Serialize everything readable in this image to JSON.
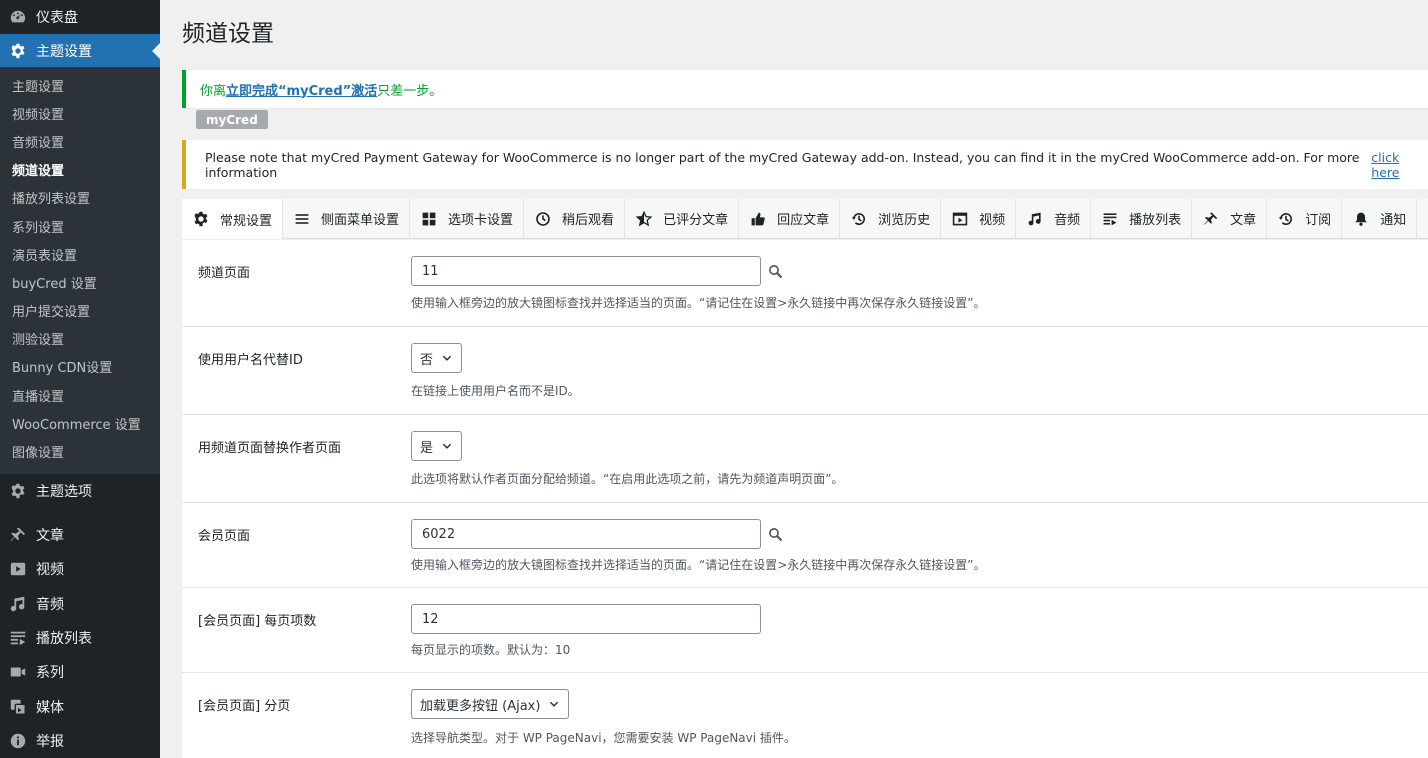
{
  "sidebar": {
    "top_items": [
      {
        "label": "仪表盘",
        "icon": "dashboard-icon"
      },
      {
        "label": "主题设置",
        "icon": "gear-icon"
      }
    ],
    "submenu": [
      {
        "label": "主题设置"
      },
      {
        "label": "视频设置"
      },
      {
        "label": "音频设置"
      },
      {
        "label": "频道设置"
      },
      {
        "label": "播放列表设置"
      },
      {
        "label": "系列设置"
      },
      {
        "label": "演员表设置"
      },
      {
        "label": "buyCred 设置"
      },
      {
        "label": "用户提交设置"
      },
      {
        "label": "测验设置"
      },
      {
        "label": "Bunny CDN设置"
      },
      {
        "label": "直播设置"
      },
      {
        "label": "WooCommerce 设置"
      },
      {
        "label": "图像设置"
      }
    ],
    "lower_items": [
      {
        "label": "主题选项",
        "icon": "gear-icon"
      },
      {
        "label": "文章",
        "icon": "pin-icon"
      },
      {
        "label": "视频",
        "icon": "video-icon"
      },
      {
        "label": "音频",
        "icon": "music-icon"
      },
      {
        "label": "播放列表",
        "icon": "playlist-icon"
      },
      {
        "label": "系列",
        "icon": "camera-icon"
      },
      {
        "label": "媒体",
        "icon": "media-icon"
      },
      {
        "label": "举报",
        "icon": "info-icon"
      }
    ]
  },
  "page": {
    "title": "频道设置"
  },
  "notice_success": {
    "prefix": "你离",
    "link": "立即完成“myCred”激活",
    "suffix": "只差一步。"
  },
  "badge": {
    "label": "myCred"
  },
  "notice_warning": {
    "text": "Please note that myCred Payment Gateway for WooCommerce is no longer part of the myCred Gateway add-on. Instead, you can find it in the myCred WooCommerce add-on. For more information",
    "link": "click here",
    "end": "."
  },
  "tabs": [
    {
      "label": "常规设置",
      "icon": "gear-icon",
      "active": true
    },
    {
      "label": "侧面菜单设置",
      "icon": "menu-icon"
    },
    {
      "label": "选项卡设置",
      "icon": "grid-icon"
    },
    {
      "label": "稍后观看",
      "icon": "clock-icon"
    },
    {
      "label": "已评分文章",
      "icon": "star-icon"
    },
    {
      "label": "回应文章",
      "icon": "thumbs-up-icon"
    },
    {
      "label": "浏览历史",
      "icon": "history-icon"
    },
    {
      "label": "视频",
      "icon": "video-icon"
    },
    {
      "label": "音频",
      "icon": "music-icon"
    },
    {
      "label": "播放列表",
      "icon": "playlist-icon"
    },
    {
      "label": "文章",
      "icon": "pin-icon"
    },
    {
      "label": "订阅",
      "icon": "history-icon"
    },
    {
      "label": "通知",
      "icon": "bell-icon"
    }
  ],
  "settings": {
    "channel_page": {
      "label": "频道页面",
      "value": "11",
      "desc": "使用输入框旁边的放大镜图标查找并选择适当的页面。“请记住在设置>永久链接中再次保存永久链接设置”。"
    },
    "use_username": {
      "label": "使用用户名代替ID",
      "value": "否",
      "desc": "在链接上使用用户名而不是ID。"
    },
    "replace_author": {
      "label": "用频道页面替换作者页面",
      "value": "是",
      "desc": "此选项将默认作者页面分配给频道。“在启用此选项之前，请先为频道声明页面”。"
    },
    "member_page": {
      "label": "会员页面",
      "value": "6022",
      "desc": "使用输入框旁边的放大镜图标查找并选择适当的页面。“请记住在设置>永久链接中再次保存永久链接设置”。"
    },
    "per_page": {
      "label": "[会员页面] 每页项数",
      "value": "12",
      "desc": "每页显示的项数。默认为：10"
    },
    "pagination": {
      "label": "[会员页面] 分页",
      "value": "加载更多按钮 (Ajax)",
      "desc": "选择导航类型。对于 WP PageNavi，您需要安装 WP PageNavi 插件。"
    }
  }
}
